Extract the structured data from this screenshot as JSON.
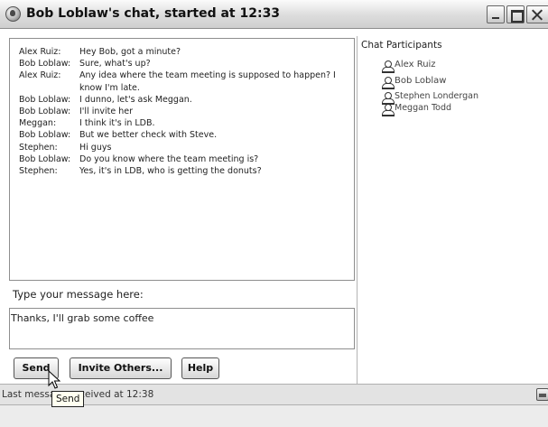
{
  "window": {
    "title": "Bob Loblaw's chat, started at 12:33",
    "app_icon": "chat-app-icon",
    "controls": [
      "minimize",
      "maximize",
      "close"
    ]
  },
  "transcript": [
    {
      "speaker": "Alex Ruiz:",
      "text": "Hey Bob, got a minute?"
    },
    {
      "speaker": "Bob Loblaw:",
      "text": "Sure, what's up?"
    },
    {
      "speaker": "Alex Ruiz:",
      "text": "Any idea where the team meeting is supposed to happen? I know I'm late."
    },
    {
      "speaker": "Bob Loblaw:",
      "text": "I dunno, let's ask Meggan."
    },
    {
      "speaker": "Bob Loblaw:",
      "text": "I'll invite her"
    },
    {
      "speaker": "Meggan:",
      "text": "I think it's in LDB."
    },
    {
      "speaker": "Bob Loblaw:",
      "text": "But we better check with Steve."
    },
    {
      "speaker": "Stephen:",
      "text": "Hi guys"
    },
    {
      "speaker": "Bob Loblaw:",
      "text": "Do you know where the team meeting is?"
    },
    {
      "speaker": "Stephen:",
      "text": "Yes, it's in LDB, who is getting the donuts?"
    }
  ],
  "participants": {
    "heading": "Chat Participants",
    "icon": "person-icon",
    "names": [
      "Alex Ruiz",
      "Bob Loblaw",
      "Stephen Londergan",
      "Meggan Todd"
    ]
  },
  "compose": {
    "label": "Type your message here:",
    "value": "Thanks, I'll grab some coffee"
  },
  "buttons": {
    "send": "Send",
    "invite": "Invite Others...",
    "help": "Help"
  },
  "status": {
    "text": "Last message received at 12:38",
    "icon": "minimize-icon"
  },
  "tooltip": "Send"
}
